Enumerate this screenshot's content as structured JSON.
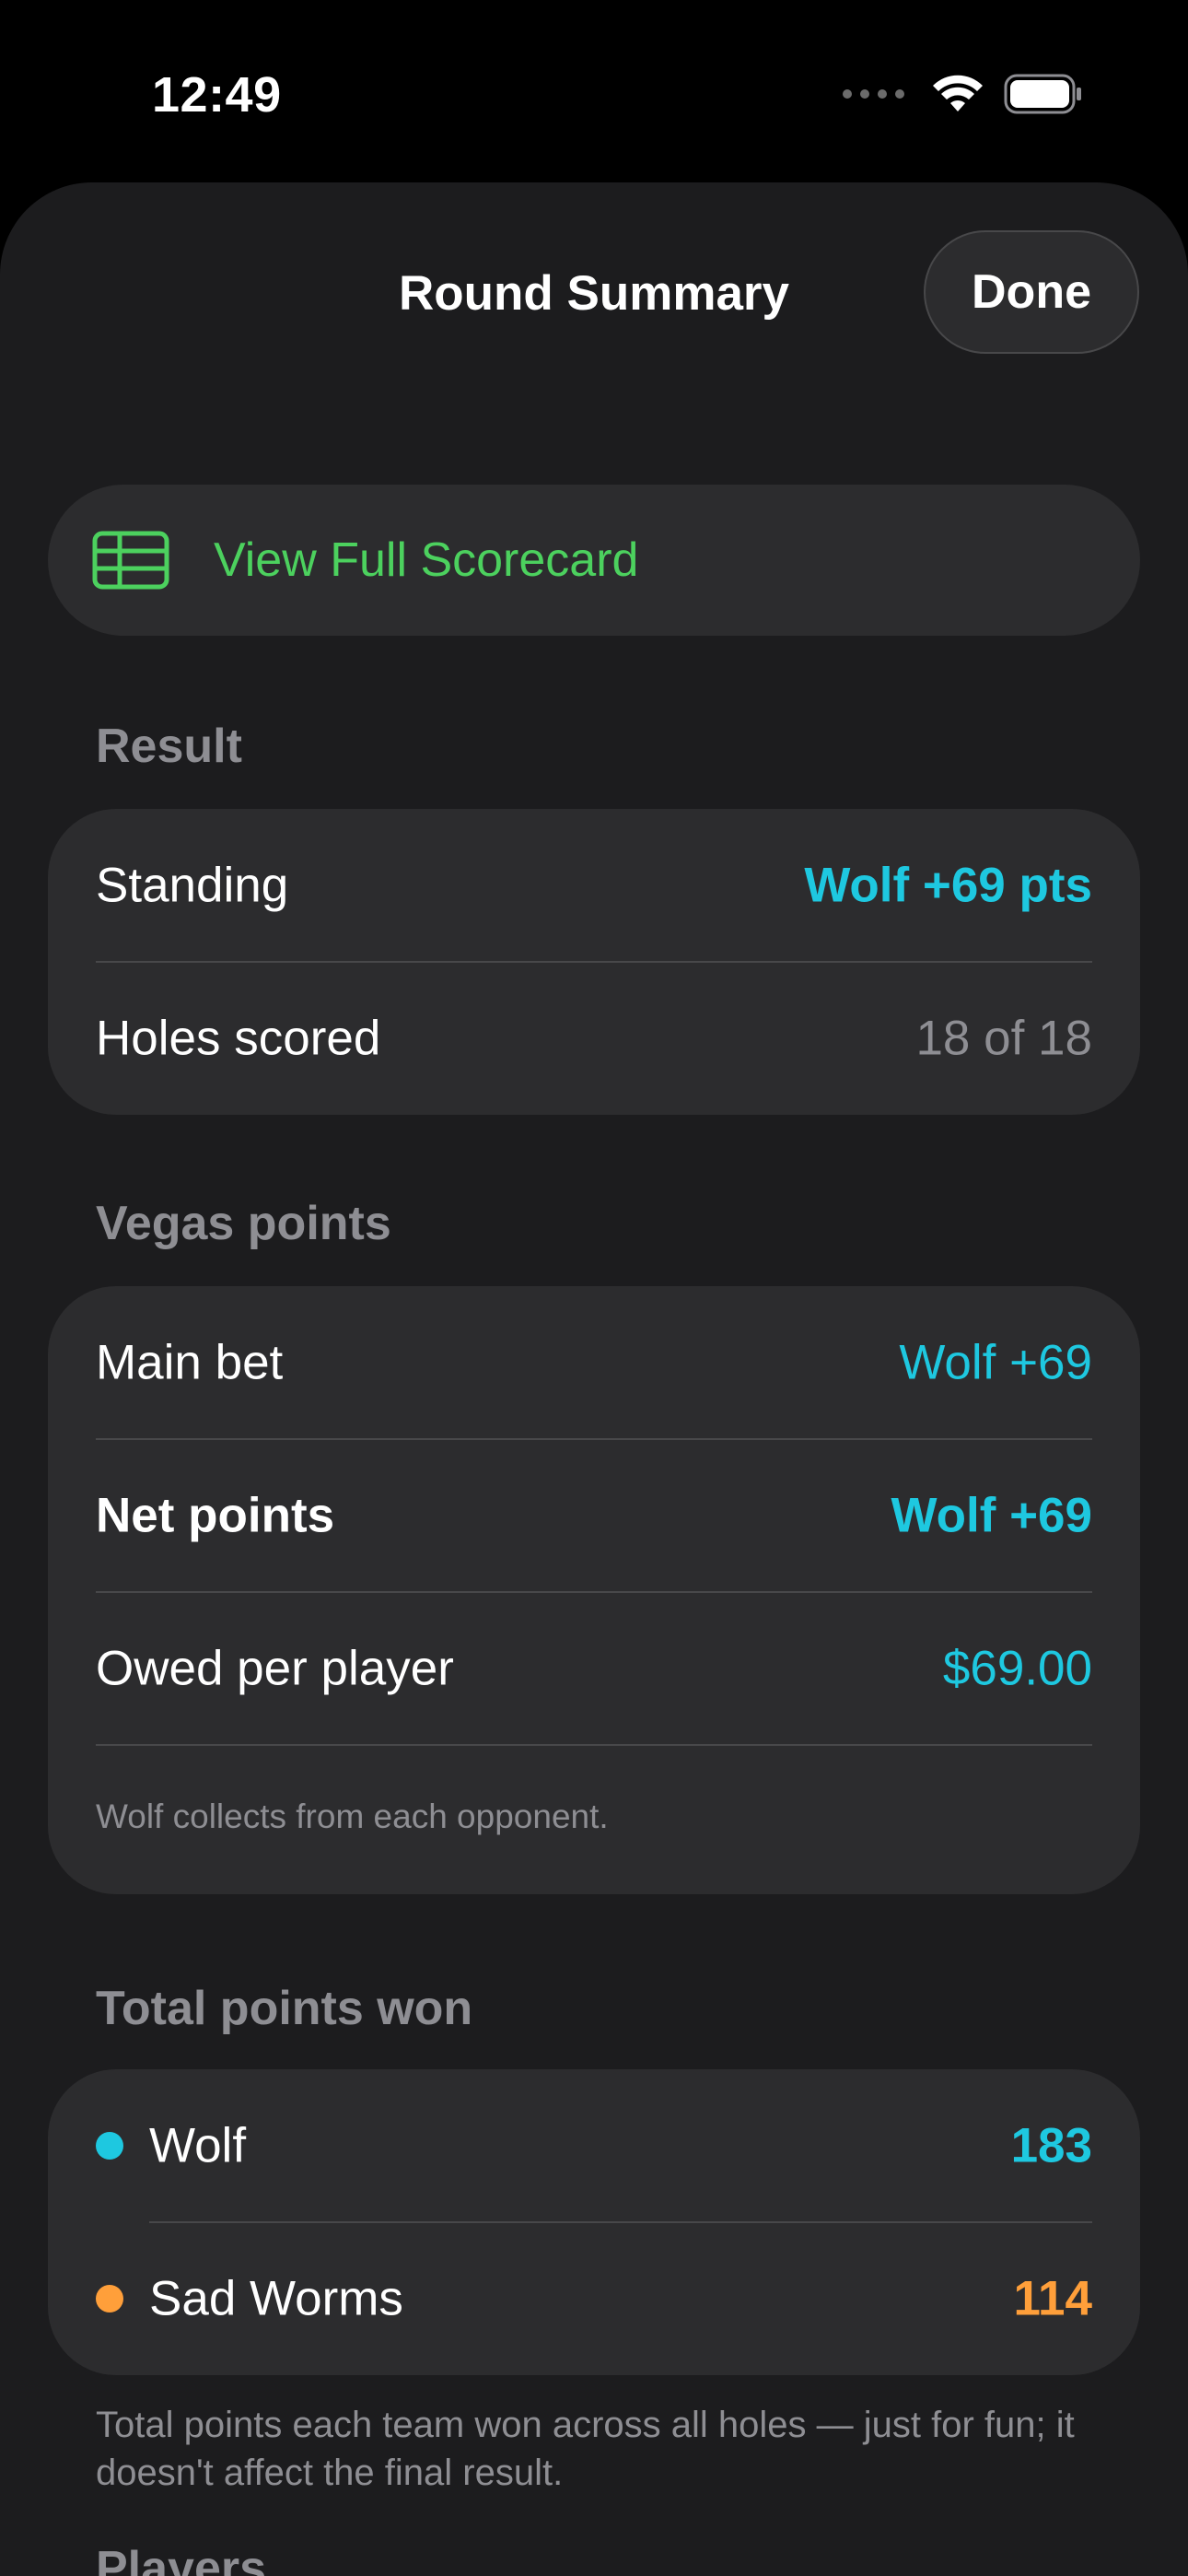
{
  "status_bar": {
    "time": "12:49"
  },
  "nav": {
    "title": "Round Summary",
    "done_label": "Done"
  },
  "scorecard_button": {
    "label": "View Full Scorecard",
    "icon": "table-icon"
  },
  "result": {
    "header": "Result",
    "rows": [
      {
        "label": "Standing",
        "value": "Wolf +69 pts"
      },
      {
        "label": "Holes scored",
        "value": "18 of 18"
      }
    ]
  },
  "vegas": {
    "header": "Vegas points",
    "rows": [
      {
        "label": "Main bet",
        "value": "Wolf +69"
      },
      {
        "label": "Net points",
        "value": "Wolf +69"
      },
      {
        "label": "Owed per player",
        "value": "$69.00"
      }
    ],
    "note": "Wolf collects from each opponent."
  },
  "total_points": {
    "header": "Total points won",
    "teams": [
      {
        "name": "Wolf",
        "points": "183",
        "color": "#1ec8e0"
      },
      {
        "name": "Sad Worms",
        "points": "114",
        "color": "#ff9f3a"
      }
    ],
    "footer": "Total points each team won across all holes — just for fun; it doesn't affect the final result."
  },
  "players": {
    "header": "Players"
  },
  "colors": {
    "accent_cyan": "#1ec8e0",
    "accent_green": "#4cd15e",
    "accent_orange": "#ff9f3a",
    "secondary_text": "#8e8e93"
  }
}
